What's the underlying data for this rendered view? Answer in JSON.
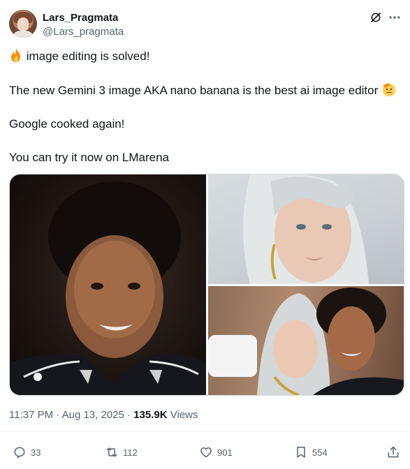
{
  "author": {
    "display_name": "Lars_Pragmata",
    "handle": "@Lars_pragmata"
  },
  "icons": {
    "grok": "grok-icon",
    "more": "more-icon",
    "fire": "fire-emoji",
    "salute": "saluting-face-emoji",
    "reply": "reply-icon",
    "repost": "repost-icon",
    "like": "heart-icon",
    "bookmark": "bookmark-icon",
    "share": "share-icon"
  },
  "tweet": {
    "line1": "image editing is solved!",
    "line2": "The new Gemini 3 image AKA nano banana is the best ai image editor",
    "line3": "Google cooked again!",
    "line4": "You can try it now on LMarena"
  },
  "meta": {
    "time": "11:37 PM",
    "date": "Aug 13, 2025",
    "views_count": "135.9K",
    "views_label": "Views",
    "sep": "·"
  },
  "actions": {
    "replies": "33",
    "reposts": "112",
    "likes": "901",
    "bookmarks": "554"
  },
  "colors": {
    "text": "#0f1419",
    "secondary": "#536471",
    "border": "#cfd9de"
  }
}
